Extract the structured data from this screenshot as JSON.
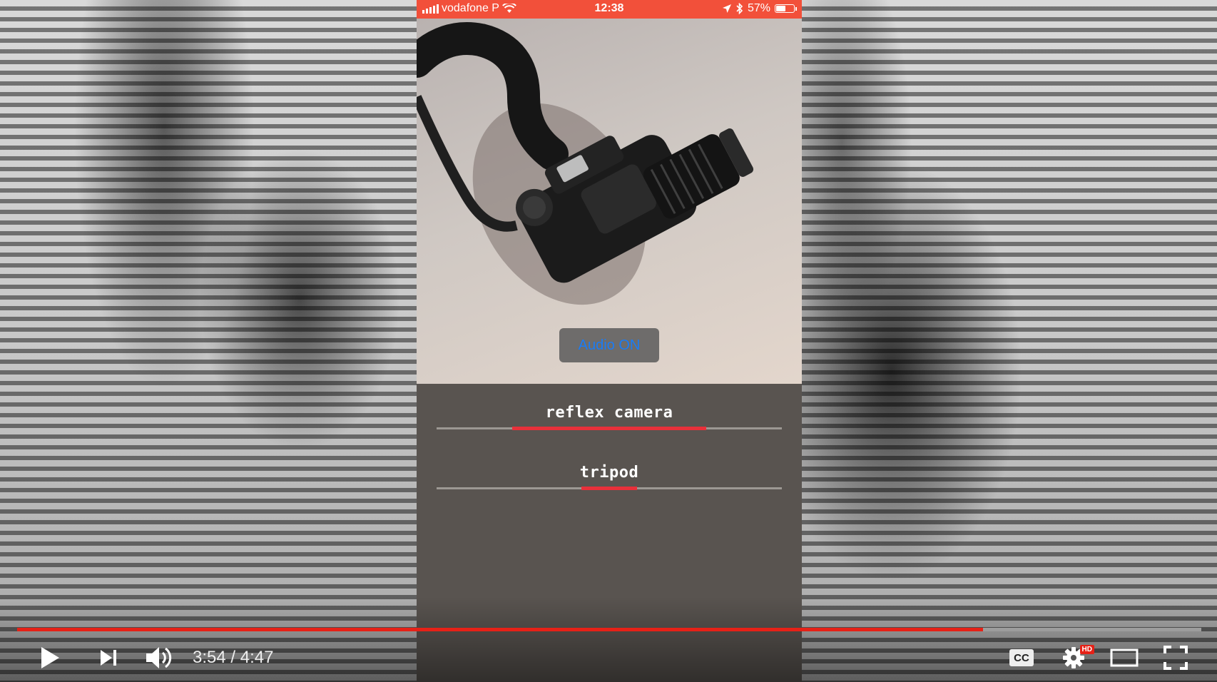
{
  "status_bar": {
    "carrier": "vodafone P",
    "time": "12:38",
    "battery": "57%",
    "battery_level": 0.57,
    "color": "#f2503a"
  },
  "preview": {
    "audio_button_label": "Audio ON"
  },
  "results": [
    {
      "label": "reflex camera",
      "confidence": 0.56
    },
    {
      "label": "tripod",
      "confidence": 0.16
    }
  ],
  "player": {
    "current_time": "3:54",
    "separator": " / ",
    "duration": "4:47",
    "progress": 0.8155,
    "played_color": "#e62117",
    "cc_label": "CC",
    "hd_label": "HD",
    "icons": [
      "play-icon",
      "next-icon",
      "volume-icon",
      "cc-icon",
      "settings-icon",
      "theater-mode-icon",
      "fullscreen-icon"
    ]
  }
}
